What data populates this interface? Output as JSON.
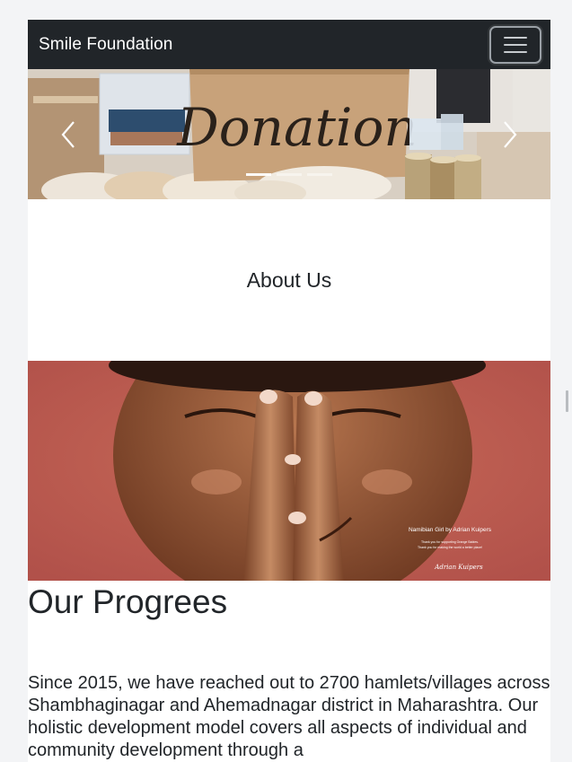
{
  "navbar": {
    "brand": "Smile Foundation",
    "toggle_icon": "hamburger-icon",
    "background": "#212529"
  },
  "carousel": {
    "sign_text": "Donation",
    "prev_icon": "chevron-left-icon",
    "next_icon": "chevron-right-icon",
    "slide_count": 3,
    "active_slide": 1
  },
  "about": {
    "heading": "About Us"
  },
  "hero": {
    "caption_title": "Namibian Girl by Adrian Kuipers",
    "caption_line1": "Thank you for supporting Orange Babies.",
    "caption_line2": "Thank you for making the world a better place!",
    "signature": "Adrian Kuipers"
  },
  "progress": {
    "heading": "Our Progrees",
    "body": "Since 2015, we have reached out to 2700 hamlets/villages across Shambhaginagar and Ahemadnagar district in Maharashtra. Our holistic development model covers all aspects of individual and community development through a"
  }
}
